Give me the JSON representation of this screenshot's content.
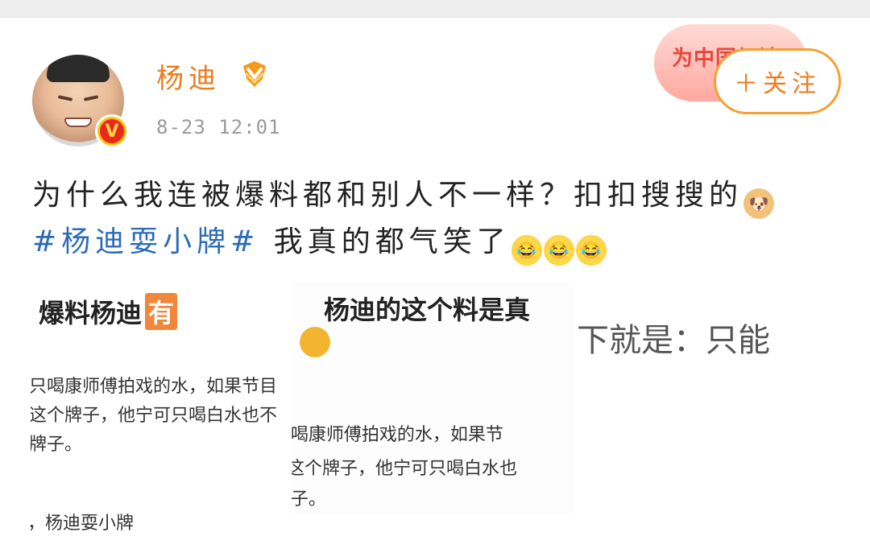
{
  "post": {
    "username": "杨迪",
    "time": "8-23 12:01",
    "follow_label": "＋关注",
    "campaign_badge": "为中国加油",
    "text_line1": "为什么我连被爆料都和别人不一样？扣扣搜搜的",
    "hashtag": "#杨迪耍小牌#",
    "text_line2": " 我真的都气笑了",
    "emojis": [
      "doge-icon",
      "crying-laughing-icon",
      "crying-laughing-icon",
      "crying-laughing-icon"
    ]
  },
  "images": {
    "image1": {
      "headline": "爆料杨迪",
      "tag": "有",
      "lines": [
        "只喝康师傅拍戏的水，如果节目",
        "这个牌子，他宁可只喝白水也不",
        "牌子。",
        "，杨迪耍小牌"
      ]
    },
    "image2": {
      "headline": "杨迪的这个料是真",
      "lines": [
        "l喝康师傅拍戏的水，如果节",
        "这个牌子，他宁可只喝白水也",
        "l子。"
      ]
    },
    "image3": {
      "headline": "下就是：只能"
    }
  },
  "colors": {
    "username": "#f07a1a",
    "hashtag": "#2b6bb8",
    "follow_border": "#f5a033"
  }
}
